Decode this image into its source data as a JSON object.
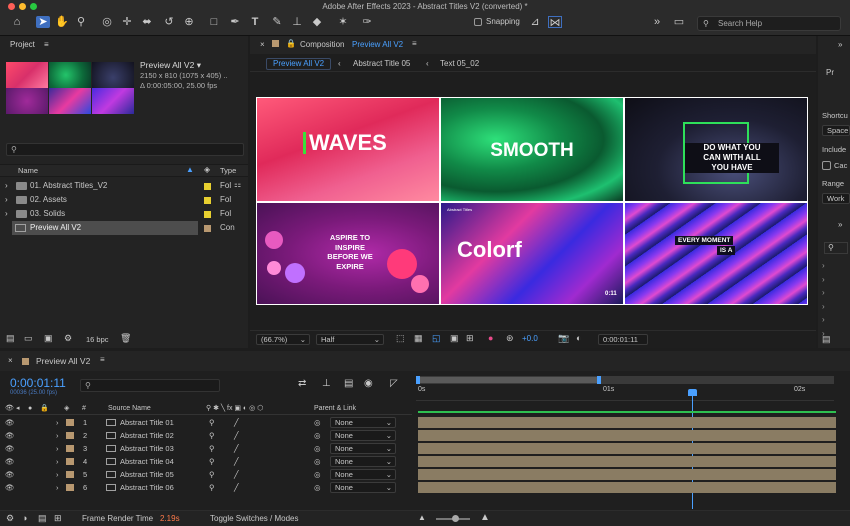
{
  "window": {
    "title": "Adobe After Effects 2023 - Abstract Titles V2 (converted) *"
  },
  "toolbar": {
    "snapping_label": "Snapping",
    "search_placeholder": "Search Help",
    "icons": [
      "home-icon",
      "selection-icon",
      "hand-icon",
      "zoom-icon",
      "orbit-icon",
      "pan-icon",
      "dolly-icon",
      "rotate-icon",
      "camera-icon",
      "rect-icon",
      "pen-icon",
      "type-icon",
      "brush-icon",
      "stamp-icon",
      "eraser-icon",
      "roto-icon",
      "puppet-icon"
    ]
  },
  "project": {
    "panel_title": "Project",
    "selected_name": "Preview All V2 ▾",
    "info_line1": "2150 x 810  (1075 x 405) ..",
    "info_line2": "Δ 0:00:05:00, 25.00 fps",
    "search_placeholder": "",
    "col_name": "Name",
    "col_type": "Type",
    "items": [
      {
        "name": "01. Abstract Titles_V2",
        "type": "Fol",
        "color": "#e8d030"
      },
      {
        "name": "02. Assets",
        "type": "Fol",
        "color": "#e8d030"
      },
      {
        "name": "03. Solids",
        "type": "Fol",
        "color": "#e8d030"
      },
      {
        "name": "Preview All V2",
        "type": "Con",
        "color": "#b89870"
      }
    ],
    "bpc": "16 bpc"
  },
  "composition": {
    "panel_prefix": "Composition",
    "panel_name": "Preview All V2",
    "breadcrumbs": [
      "Preview All V2",
      "Abstract Title 05",
      "Text 05_02"
    ],
    "zoom": "(66.7%)",
    "resolution": "Half",
    "exposure": "+0.0",
    "timecode": "0:00:01:11",
    "cells": {
      "waves": "WAVES",
      "smooth": "SMOOTH",
      "do_what": "DO WHAT YOU\nCAN WITH ALL\nYOU HAVE",
      "aspire": "ASPIRE TO\nINSPIRE\nBEFORE WE\nEXPIRE",
      "colorful": "Colorf",
      "small_label": "Abstract Titles",
      "page_num": "0:11",
      "every_moment": "EVERY MOMENT",
      "is_a": "IS A"
    }
  },
  "right_panel": {
    "pr": "Pr",
    "shortcut": "Shortcu",
    "space": "Space",
    "include": "Include",
    "cache": "Cac",
    "range": "Range",
    "work": "Work"
  },
  "timeline": {
    "tab_label": "Preview All V2",
    "timecode": "0:00:01:11",
    "timecode_sub": "00036 (25.00 fps)",
    "search_placeholder": "",
    "col_source": "Source Name",
    "col_parent": "Parent & Link",
    "ruler": [
      "0s",
      "01s",
      "02s"
    ],
    "layers": [
      {
        "num": "1",
        "name": "Abstract Title 01",
        "parent": "None"
      },
      {
        "num": "2",
        "name": "Abstract Title 02",
        "parent": "None"
      },
      {
        "num": "3",
        "name": "Abstract Title 03",
        "parent": "None"
      },
      {
        "num": "4",
        "name": "Abstract Title 04",
        "parent": "None"
      },
      {
        "num": "5",
        "name": "Abstract Title 05",
        "parent": "None"
      },
      {
        "num": "6",
        "name": "Abstract Title 06",
        "parent": "None"
      }
    ],
    "render_label": "Frame Render Time",
    "render_value": "2.19s",
    "toggle_label": "Toggle Switches / Modes"
  }
}
